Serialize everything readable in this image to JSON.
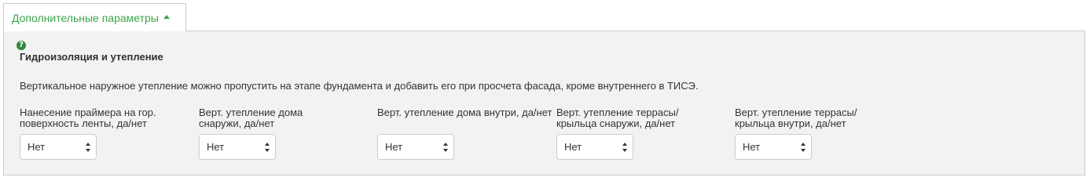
{
  "tab": {
    "label": "Дополнительные параметры",
    "icon": "caret-up-icon",
    "accent_color": "#3aa54a"
  },
  "panel": {
    "help_icon": "?",
    "title": "Гидроизоляция и утепление",
    "note": "Вертикальное наружное утепление можно пропустить на этапе фундамента и добавить его при просчета фасада, кроме внутреннего в ТИСЭ.",
    "fields": [
      {
        "label": "Нанесение праймера на гор. поверхность ленты, да/нет",
        "value": "Нет"
      },
      {
        "label": "Верт. утепление дома снаружи, да/нет",
        "value": "Нет"
      },
      {
        "label": "Верт. утепление дома внутри, да/нет",
        "value": "Нет"
      },
      {
        "label": "Верт. утепление террасы/ крыльца снаружи, да/нет",
        "value": "Нет"
      },
      {
        "label": "Верт. утепление террасы/ крыльца внутри, да/нет",
        "value": "Нет"
      }
    ]
  }
}
